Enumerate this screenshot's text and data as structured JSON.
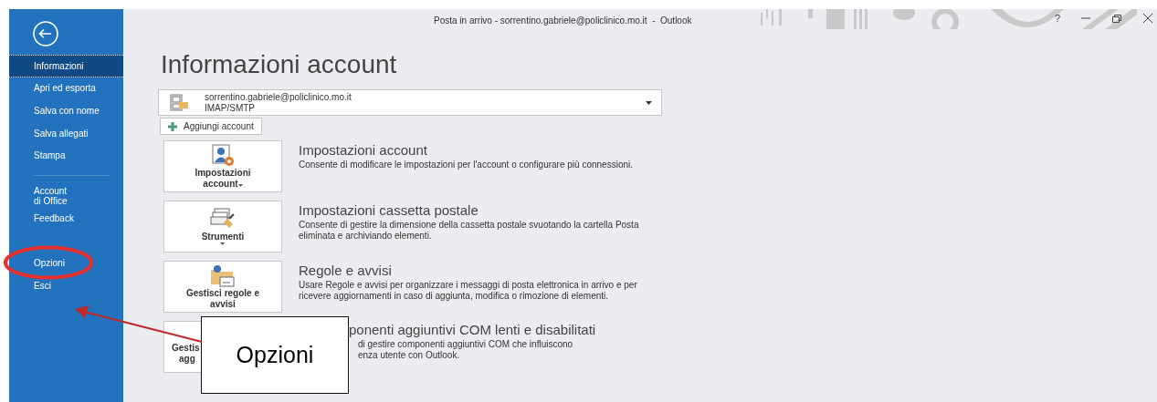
{
  "window": {
    "title": "Posta in arrivo - sorrentino.gabriele@policlinico.mo.it  -  Outlook",
    "help": "?"
  },
  "sidebar": {
    "items": [
      {
        "label": "Informazioni",
        "selected": true,
        "divider_after": false
      },
      {
        "label": "Apri ed esporta",
        "selected": false,
        "divider_after": false
      },
      {
        "label": "Salva con nome",
        "selected": false,
        "divider_after": false
      },
      {
        "label": "Salva allegati",
        "selected": false,
        "divider_after": false
      },
      {
        "label": "Stampa",
        "selected": false,
        "divider_after": true
      },
      {
        "label": "Account\ndi Office",
        "selected": false,
        "divider_after": false
      },
      {
        "label": "Feedback",
        "selected": false,
        "divider_after": false
      },
      {
        "label": "Opzioni",
        "selected": false,
        "divider_after": false,
        "highlighted": true
      },
      {
        "label": "Esci",
        "selected": false,
        "divider_after": false
      }
    ]
  },
  "page": {
    "title": "Informazioni account",
    "account": {
      "email": "sorrentino.gabriele@policlinico.mo.it",
      "type": "IMAP/SMTP"
    },
    "add_account": "Aggiungi account",
    "cards": [
      {
        "kind": "account",
        "button": [
          "Impostazioni",
          "account"
        ],
        "has_menu": true,
        "title": "Impostazioni account",
        "description": "Consente di modificare le impostazioni per l'account o configurare più connessioni."
      },
      {
        "kind": "tools",
        "button": [
          "Strumenti"
        ],
        "has_menu": true,
        "title": "Impostazioni cassetta postale",
        "description": "Consente di gestire la dimensione della cassetta postale svuotando la cartella Posta eliminata e archiviando elementi."
      },
      {
        "kind": "rules",
        "button": [
          "Gestisci regole e",
          "avvisi"
        ],
        "has_menu": false,
        "title": "Regole e avvisi",
        "description": "Usare Regole e avvisi per organizzare i messaggi di posta elettronica in arrivo e per ricevere aggiornamenti in caso di aggiunta, modifica o rimozione di elementi."
      },
      {
        "button": [
          "Gestis",
          "agg"
        ],
        "has_menu": false,
        "title": "ponenti aggiuntivi COM lenti e disabilitati",
        "description": "di gestire componenti aggiuntivi COM che influiscono\nenza utente con Outlook.",
        "callout": "Opzioni"
      }
    ]
  }
}
